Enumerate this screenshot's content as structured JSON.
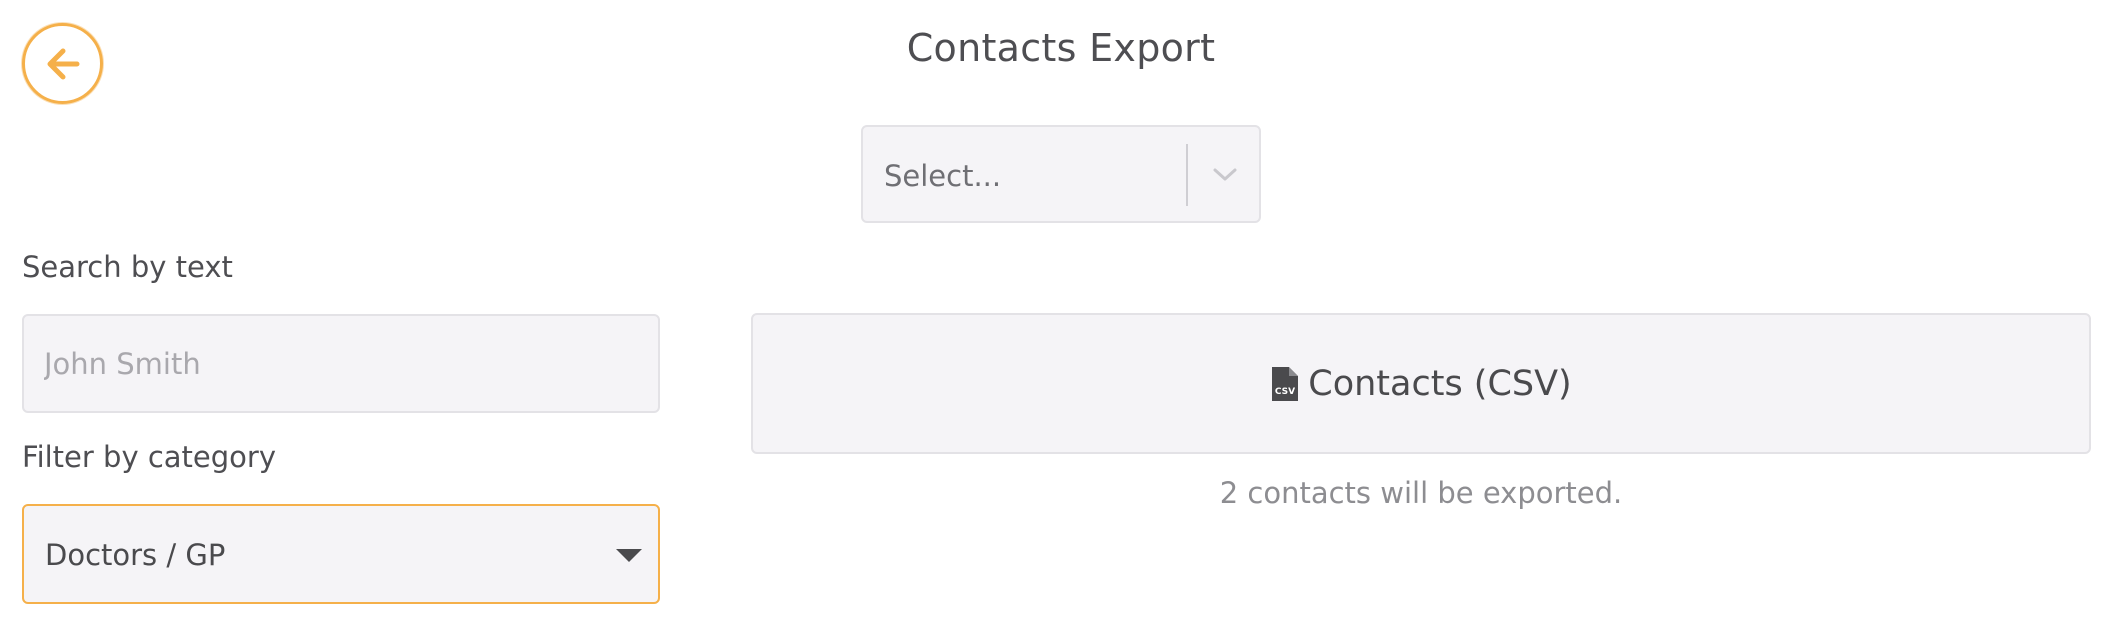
{
  "colors": {
    "accent": "#f5b04a",
    "field_background": "#f5f4f7",
    "field_border": "#e3e2e6",
    "text": "#4a4a4d",
    "muted_text": "#8d8d91"
  },
  "header": {
    "back_icon": "arrow-left-icon",
    "title": "Contacts Export"
  },
  "format_select": {
    "placeholder": "Select...",
    "icon": "chevron-down-icon"
  },
  "filters": {
    "search_label": "Search by text",
    "search_placeholder": "John Smith",
    "search_value": "",
    "category_label": "Filter by category",
    "category_value": "Doctors / GP",
    "category_icon": "caret-down-icon"
  },
  "export": {
    "icon": "csv-file-icon",
    "button_label": "Contacts (CSV)",
    "note": "2 contacts will be exported."
  }
}
